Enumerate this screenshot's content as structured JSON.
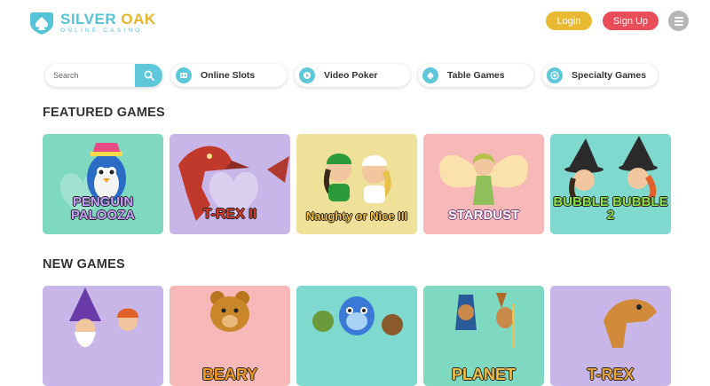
{
  "brand": {
    "name_part1": "SILVER",
    "name_part2": "OAK",
    "tagline": "ONLINE CASINO",
    "colors": {
      "teal": "#55c4d6",
      "gold": "#e6b52a"
    }
  },
  "header": {
    "login_label": "Login",
    "signup_label": "Sign Up",
    "menu_icon": "hamburger-menu-icon",
    "colors": {
      "login": "#e8b931",
      "signup": "#e94d58",
      "menu": "#b6b6b6"
    }
  },
  "nav": {
    "search": {
      "placeholder": "Search",
      "icon": "search-icon"
    },
    "categories": [
      {
        "label": "Online Slots",
        "icon": "slots-icon"
      },
      {
        "label": "Video Poker",
        "icon": "play-icon"
      },
      {
        "label": "Table Games",
        "icon": "spade-icon"
      },
      {
        "label": "Specialty Games",
        "icon": "target-icon"
      }
    ]
  },
  "sections": {
    "featured": {
      "title": "FEATURED GAMES",
      "games": [
        {
          "title": "PENGUIN PALOOZA",
          "bg": "#7fd9c0"
        },
        {
          "title": "T-REX II",
          "bg": "#c8b6e8"
        },
        {
          "title": "Naughty or Nice III",
          "bg": "#efe09a"
        },
        {
          "title": "STARDUST",
          "bg": "#f7b8b8"
        },
        {
          "title": "BUBBLE BUBBLE 2",
          "bg": "#7fd9cf"
        }
      ]
    },
    "new": {
      "title": "NEW GAMES",
      "games": [
        {
          "title": "",
          "bg": "#c8b6e8"
        },
        {
          "title": "BEARY",
          "bg": "#f7b8b8"
        },
        {
          "title": "",
          "bg": "#7fd9cf"
        },
        {
          "title": "PLANET",
          "bg": "#7fd9c0"
        },
        {
          "title": "T-REX",
          "bg": "#c8b6e8"
        }
      ]
    }
  }
}
